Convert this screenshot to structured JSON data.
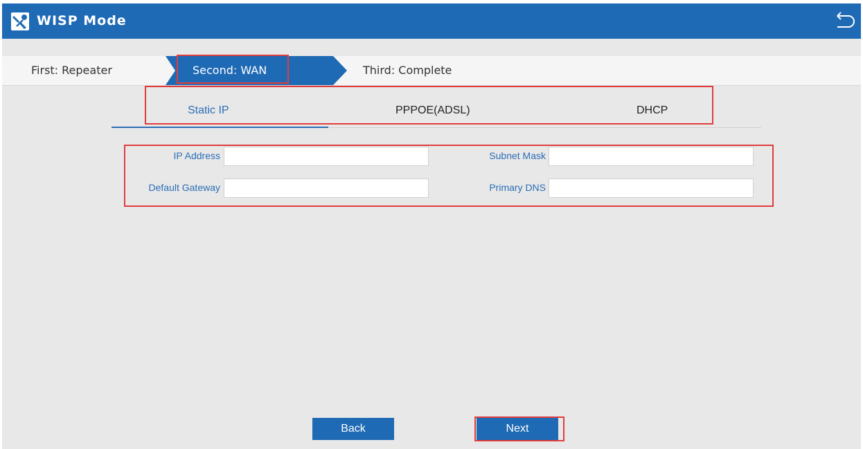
{
  "header": {
    "title": "WISP Mode",
    "logo_icon": "wrench-screwdriver-icon",
    "back_icon": "undo-arrow-icon"
  },
  "steps": [
    {
      "label": "First: Repeater"
    },
    {
      "label": "Second: WAN",
      "active": true
    },
    {
      "label": "Third: Complete"
    }
  ],
  "tabs": [
    {
      "label": "Static IP",
      "active": true
    },
    {
      "label": "PPPOE(ADSL)"
    },
    {
      "label": "DHCP"
    }
  ],
  "form": {
    "ip_address": {
      "label": "IP Address",
      "value": ""
    },
    "subnet_mask": {
      "label": "Subnet Mask",
      "value": ""
    },
    "default_gateway": {
      "label": "Default Gateway",
      "value": ""
    },
    "primary_dns": {
      "label": "Primary DNS",
      "value": ""
    }
  },
  "buttons": {
    "back": "Back",
    "next": "Next"
  },
  "colors": {
    "primary": "#1f6ab5",
    "highlight": "#e23b3b",
    "background": "#e8e8e8"
  }
}
